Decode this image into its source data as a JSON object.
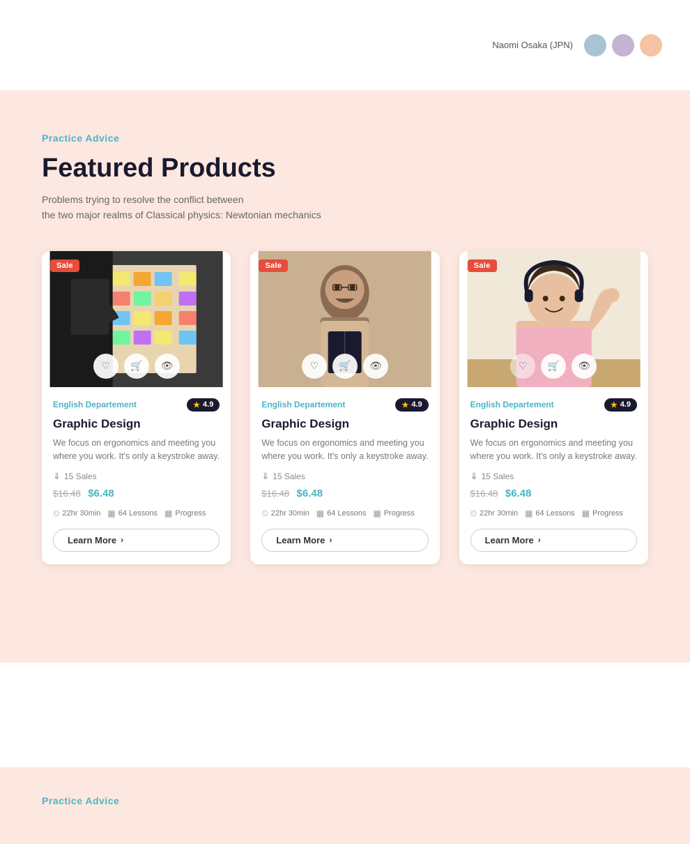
{
  "topbar": {
    "user_name": "Naomi Osaka (JPN)",
    "avatar_colors": [
      "#a8c4d4",
      "#c4b4d4",
      "#f4c4a4"
    ]
  },
  "featured": {
    "label": "Practice Advice",
    "title": "Featured Products",
    "desc_line1": "Problems trying to resolve the conflict between",
    "desc_line2": "the two major realms of Classical physics: Newtonian mechanics"
  },
  "cards": [
    {
      "sale_badge": "Sale",
      "department": "English Departement",
      "rating": "4.9",
      "title": "Graphic Design",
      "description": "We focus on ergonomics and meeting you where you work. It's only a keystroke away.",
      "sales_count": "15 Sales",
      "price_original": "$16.48",
      "price_sale": "$6.48",
      "duration": "22hr 30min",
      "lessons": "64 Lessons",
      "progress": "Progress",
      "learn_more": "Learn More"
    },
    {
      "sale_badge": "Sale",
      "department": "English Departement",
      "rating": "4.9",
      "title": "Graphic Design",
      "description": "We focus on ergonomics and meeting you where you work. It's only a keystroke away.",
      "sales_count": "15 Sales",
      "price_original": "$16.48",
      "price_sale": "$6.48",
      "duration": "22hr 30min",
      "lessons": "64 Lessons",
      "progress": "Progress",
      "learn_more": "Learn More"
    },
    {
      "sale_badge": "Sale",
      "department": "English Departement",
      "rating": "4.9",
      "title": "Graphic Design",
      "description": "We focus on ergonomics and meeting you where you work. It's only a keystroke away.",
      "sales_count": "15 Sales",
      "price_original": "$16.48",
      "price_sale": "$6.48",
      "duration": "22hr 30min",
      "lessons": "64 Lessons",
      "progress": "Progress",
      "learn_more": "Learn More"
    }
  ],
  "bottom_section": {
    "label": "Practice Advice"
  }
}
